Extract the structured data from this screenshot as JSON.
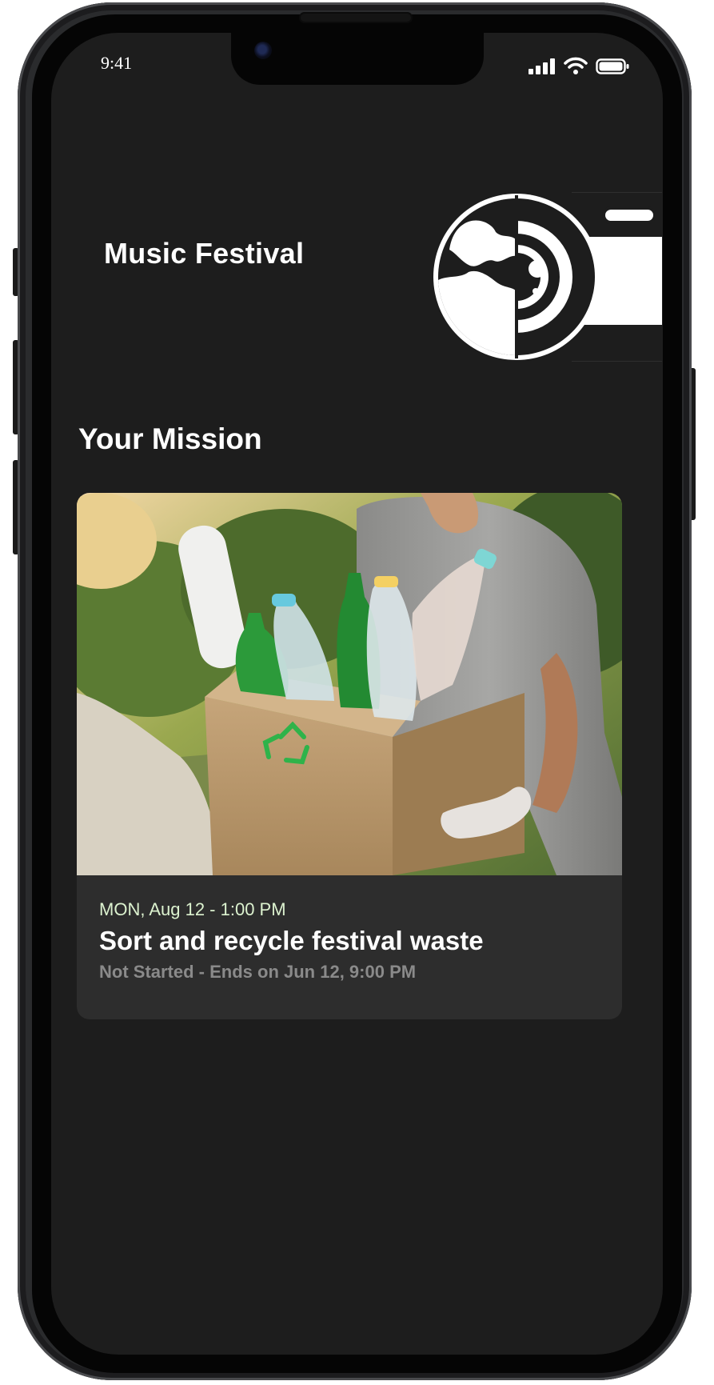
{
  "status_bar": {
    "time": "9:41",
    "icons": [
      "cellular-signal-icon",
      "wifi-icon",
      "battery-icon"
    ]
  },
  "header": {
    "title": "Music Festival",
    "logo": "earth-camera-logo"
  },
  "section": {
    "title": "Your Mission"
  },
  "mission_card": {
    "image": "recycling-box-photo",
    "date": "MON, Aug 12 - 1:00 PM",
    "title": "Sort and recycle festival waste",
    "status": "Not Started - Ends on Jun 12, 9:00 PM"
  },
  "colors": {
    "background": "#1d1d1d",
    "card": "#2d2d2d",
    "date_text": "#dcf2cf",
    "status_text": "#8a8a8a"
  }
}
